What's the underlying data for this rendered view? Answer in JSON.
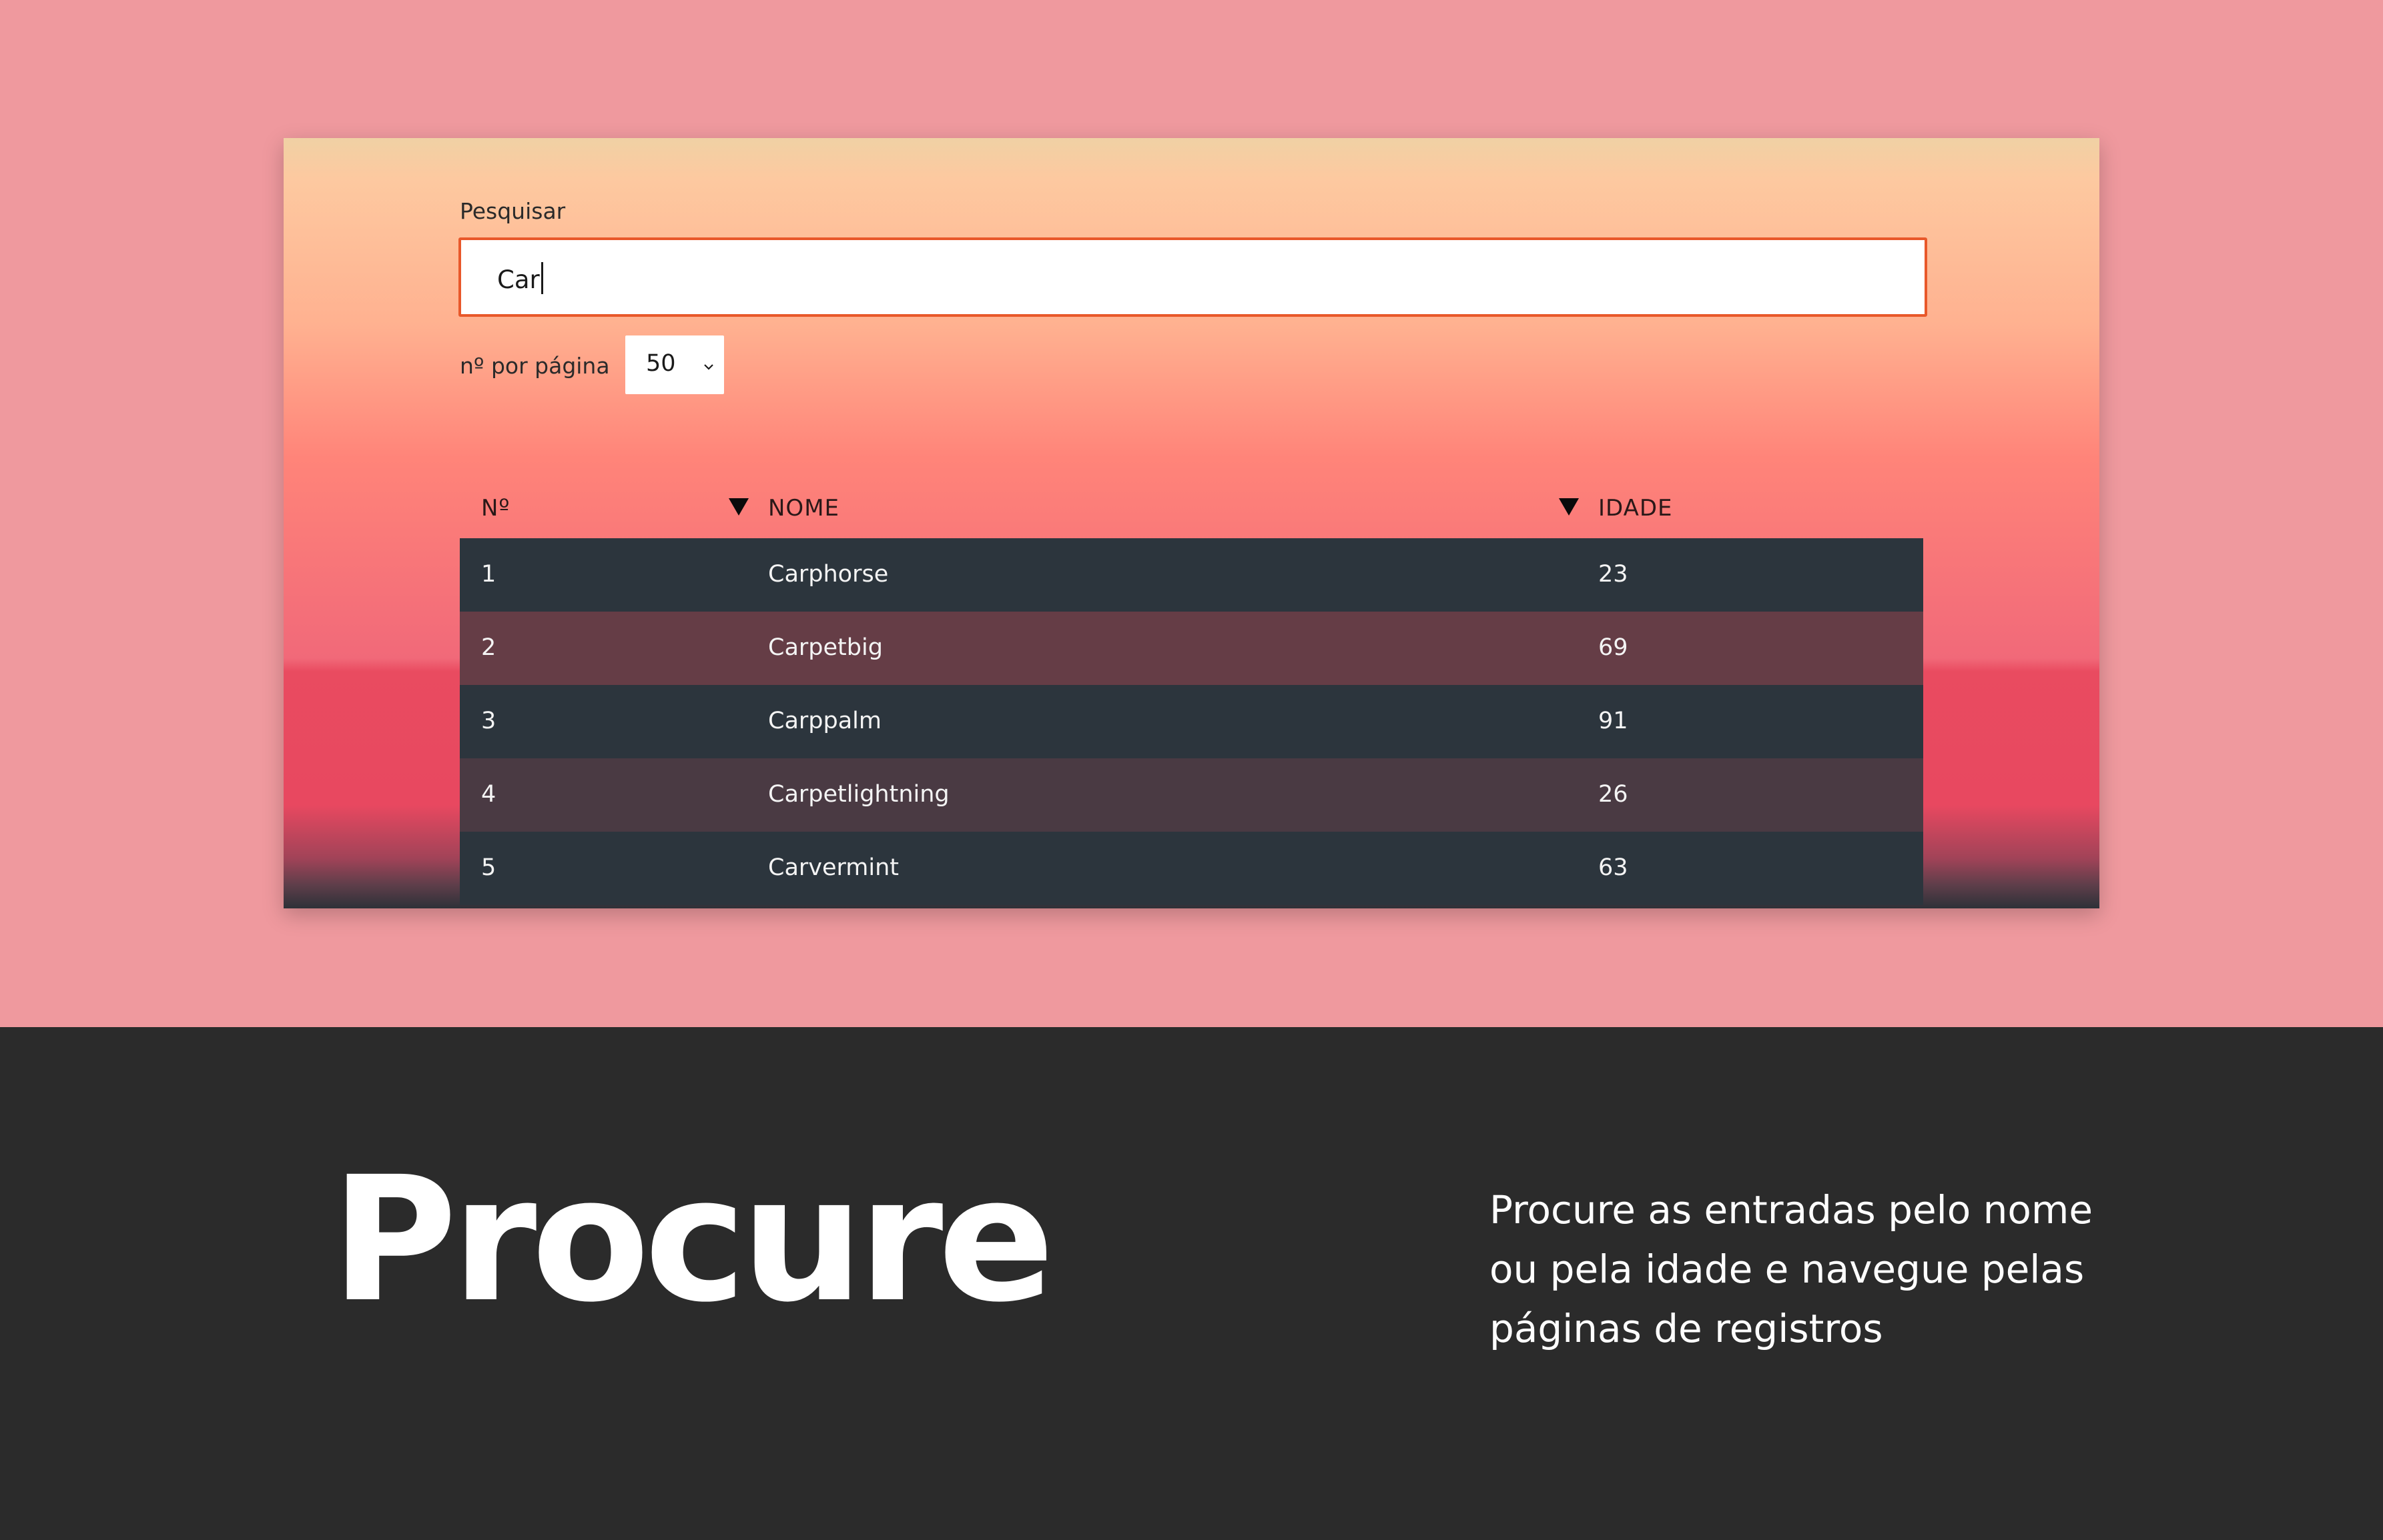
{
  "search": {
    "label": "Pesquisar",
    "value": "Car"
  },
  "pagination": {
    "label": "nº por página",
    "selected": "50"
  },
  "table": {
    "columns": [
      "Nº",
      "NOME",
      "IDADE"
    ],
    "rows": [
      [
        "1",
        "Carphorse",
        "23"
      ],
      [
        "2",
        "Carpetbig",
        "69"
      ],
      [
        "3",
        "Carppalm",
        "91"
      ],
      [
        "4",
        "Carpetlightning",
        "26"
      ],
      [
        "5",
        "Carvermint",
        "63"
      ]
    ]
  },
  "promo": {
    "headline": "Procure",
    "description_lines": [
      "Procure as entradas pelo nome",
      "ou pela idade e navegue pelas",
      "páginas de registros"
    ]
  },
  "colors": {
    "page_background": "#ef999e",
    "footer_background": "#2b2b2b",
    "input_accent": "#e8582a",
    "row_dark": "#2c353d",
    "row_alt": "#653d46"
  },
  "icons": {
    "sort": "sort-down-triangle-icon",
    "select": "chevron-down-icon"
  }
}
